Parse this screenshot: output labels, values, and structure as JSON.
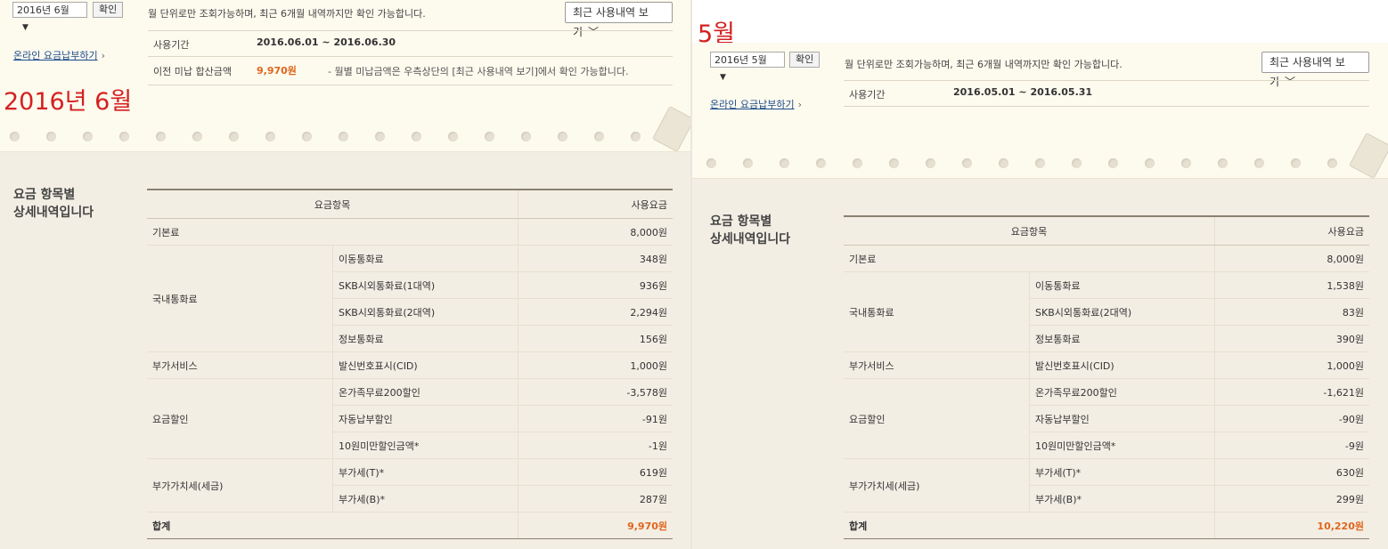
{
  "june": {
    "annotation": "2016년 6월",
    "year_select": "2016년",
    "month_select": "6월",
    "confirm_label": "확인",
    "notice": "월 단위로만 조회가능하며, 최근 6개월 내역까지만 확인 가능합니다.",
    "history_button": "최근 사용내역 보기",
    "pay_link": "온라인 요금납부하기",
    "period_label": "사용기간",
    "period_value": "2016.06.01  ~  2016.06.30",
    "unpaid_label": "이전 미납 합산금액",
    "unpaid_amount": "9,970원",
    "unpaid_note": "- 월별 미납금액은 우측상단의 [최근 사용내역 보기]에서 확인 가능합니다.",
    "heading_line1": "요금 항목별",
    "heading_line2": "상세내역입니다",
    "col_item": "요금항목",
    "col_fee": "사용요금",
    "rows": [
      {
        "group": "기본료",
        "item": "",
        "fee": "8,000원"
      },
      {
        "group": "국내통화료",
        "item": "이동통화료",
        "fee": "348원"
      },
      {
        "group": "",
        "item": "SKB시외통화료(1대역)",
        "fee": "936원"
      },
      {
        "group": "",
        "item": "SKB시외통화료(2대역)",
        "fee": "2,294원"
      },
      {
        "group": "",
        "item": "정보통화료",
        "fee": "156원"
      },
      {
        "group": "부가서비스",
        "item": "발신번호표시(CID)",
        "fee": "1,000원"
      },
      {
        "group": "요금할인",
        "item": "온가족무료200할인",
        "fee": "-3,578원"
      },
      {
        "group": "",
        "item": "자동납부할인",
        "fee": "-91원"
      },
      {
        "group": "",
        "item": "10원미만할인금액*",
        "fee": "-1원"
      },
      {
        "group": "부가가치세(세금)",
        "item": "부가세(T)*",
        "fee": "619원"
      },
      {
        "group": "",
        "item": "부가세(B)*",
        "fee": "287원"
      }
    ],
    "total_label": "합계",
    "total_value": "9,970원"
  },
  "may": {
    "annotation": "5월",
    "year_select": "2016년",
    "month_select": "5월",
    "confirm_label": "확인",
    "notice": "월 단위로만 조회가능하며, 최근 6개월 내역까지만 확인 가능합니다.",
    "history_button": "최근 사용내역 보기",
    "pay_link": "온라인 요금납부하기",
    "period_label": "사용기간",
    "period_value": "2016.05.01  ~  2016.05.31",
    "heading_line1": "요금 항목별",
    "heading_line2": "상세내역입니다",
    "col_item": "요금항목",
    "col_fee": "사용요금",
    "rows": [
      {
        "group": "기본료",
        "item": "",
        "fee": "8,000원"
      },
      {
        "group": "국내통화료",
        "item": "이동통화료",
        "fee": "1,538원"
      },
      {
        "group": "",
        "item": "SKB시외통화료(2대역)",
        "fee": "83원"
      },
      {
        "group": "",
        "item": "정보통화료",
        "fee": "390원"
      },
      {
        "group": "부가서비스",
        "item": "발신번호표시(CID)",
        "fee": "1,000원"
      },
      {
        "group": "요금할인",
        "item": "온가족무료200할인",
        "fee": "-1,621원"
      },
      {
        "group": "",
        "item": "자동납부할인",
        "fee": "-90원"
      },
      {
        "group": "",
        "item": "10원미만할인금액*",
        "fee": "-9원"
      },
      {
        "group": "부가가치세(세금)",
        "item": "부가세(T)*",
        "fee": "630원"
      },
      {
        "group": "",
        "item": "부가세(B)*",
        "fee": "299원"
      }
    ],
    "total_label": "합계",
    "total_value": "10,220원"
  }
}
